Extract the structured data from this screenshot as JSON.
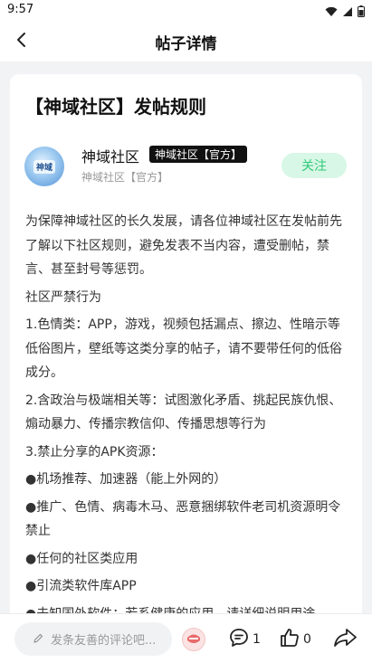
{
  "status_bar": {
    "time": "9:57"
  },
  "header": {
    "title": "帖子详情"
  },
  "post": {
    "title": "【神域社区】发帖规则",
    "author": {
      "name": "神域社区",
      "badge": "神域社区【官方】",
      "subtitle": "神域社区【官方】",
      "avatar_text": "神域",
      "follow_label": "关注"
    },
    "paragraphs": [
      "为保障神域社区的长久发展，请各位神域社区在发帖前先了解以下社区规则，避免发表不当内容，遭受删帖，禁言、甚至封号等惩罚。",
      "社区严禁行为",
      "1.色情类：APP，游戏，视频包括漏点、擦边、性暗示等低俗图片，壁纸等这类分享的帖子，请不要带任何的低俗成分。",
      "2.含政治与极端相关等：试图激化矛盾、挑起民族仇恨、煽动暴力、传播宗教信仰、传播思想等行为",
      "3.禁止分享的APK资源：",
      "●机场推荐、加速器（能上外网的）",
      "●推广、色情、病毒木马、恶意捆绑软件老司机资源明令禁止",
      "●任何的社区类应用",
      "●引流类软件库APP",
      "●未知国外软件：若系健康的应用，请详细说明用途"
    ]
  },
  "bottom_bar": {
    "comment_placeholder": "发条友善的评论吧...",
    "comment_count": "1",
    "like_count": "0"
  },
  "colors": {
    "accent_green": "#2fc978",
    "follow_bg": "#d8f7e6",
    "badge_bg": "#111111",
    "page_bg": "#f2f3f5"
  },
  "icons": [
    "back-arrow-icon",
    "wifi-icon",
    "signal-icon",
    "battery-icon",
    "pencil-icon",
    "comment-icon",
    "thumbs-up-icon",
    "share-icon"
  ]
}
